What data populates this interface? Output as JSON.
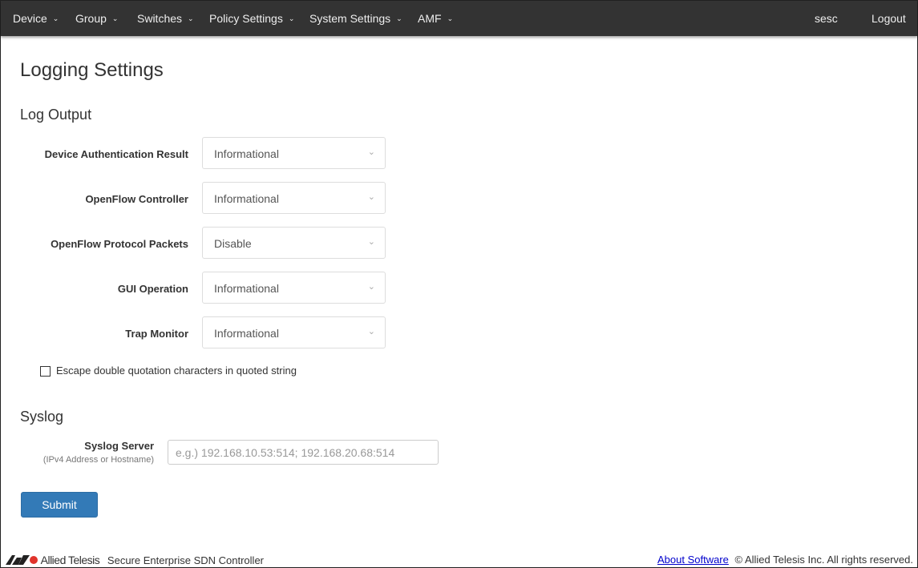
{
  "nav": {
    "items": [
      "Device",
      "Group",
      "Switches",
      "Policy Settings",
      "System Settings",
      "AMF"
    ],
    "user": "sesc",
    "logout": "Logout"
  },
  "page_title": "Logging Settings",
  "log_output": {
    "heading": "Log Output",
    "fields": [
      {
        "label": "Device Authentication Result",
        "value": "Informational"
      },
      {
        "label": "OpenFlow Controller",
        "value": "Informational"
      },
      {
        "label": "OpenFlow Protocol Packets",
        "value": "Disable"
      },
      {
        "label": "GUI Operation",
        "value": "Informational"
      },
      {
        "label": "Trap Monitor",
        "value": "Informational"
      }
    ],
    "escape_checkbox": {
      "label": "Escape double quotation characters in quoted string",
      "checked": false
    }
  },
  "syslog": {
    "heading": "Syslog",
    "server_label": "Syslog Server",
    "server_sublabel": "(IPv4 Address or Hostname)",
    "server_value": "",
    "server_placeholder": "e.g.) 192.168.10.53:514; 192.168.20.68:514"
  },
  "submit": "Submit",
  "footer": {
    "brand": "Allied Telesis",
    "product": "Secure Enterprise SDN Controller",
    "about": "About Software",
    "copyright": "© Allied Telesis Inc. All rights reserved."
  }
}
